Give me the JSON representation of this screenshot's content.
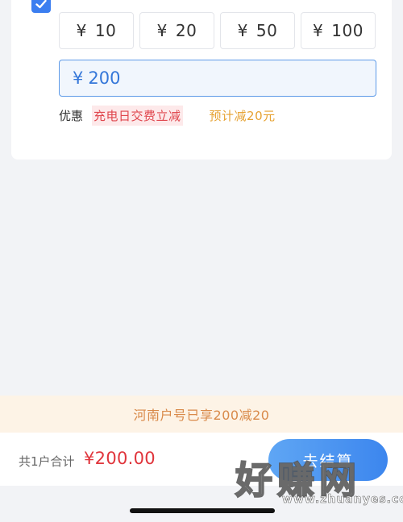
{
  "amount_options": [
    {
      "currency": "¥",
      "value": "10"
    },
    {
      "currency": "¥",
      "value": "20"
    },
    {
      "currency": "¥",
      "value": "50"
    },
    {
      "currency": "¥",
      "value": "100"
    }
  ],
  "custom_amount": {
    "currency": "¥",
    "value": "200"
  },
  "promo": {
    "label": "优惠",
    "tag": "充电日交费立减",
    "estimate": "预计减20元"
  },
  "banner_text": "河南户号已享200减20",
  "footer": {
    "total_label": "共1户合计",
    "total_amount": "¥200.00",
    "checkout_label": "去结算"
  },
  "watermark": {
    "big": "好赚网",
    "small": "www.zhuanyes.com"
  },
  "colors": {
    "accent": "#3b7ef0",
    "price": "#e0353c",
    "promo_tag": "#e0474e",
    "promo_estimate": "#e6a232",
    "banner_text": "#d98a4a"
  },
  "icons": {
    "checkbox": "checkmark-icon"
  }
}
